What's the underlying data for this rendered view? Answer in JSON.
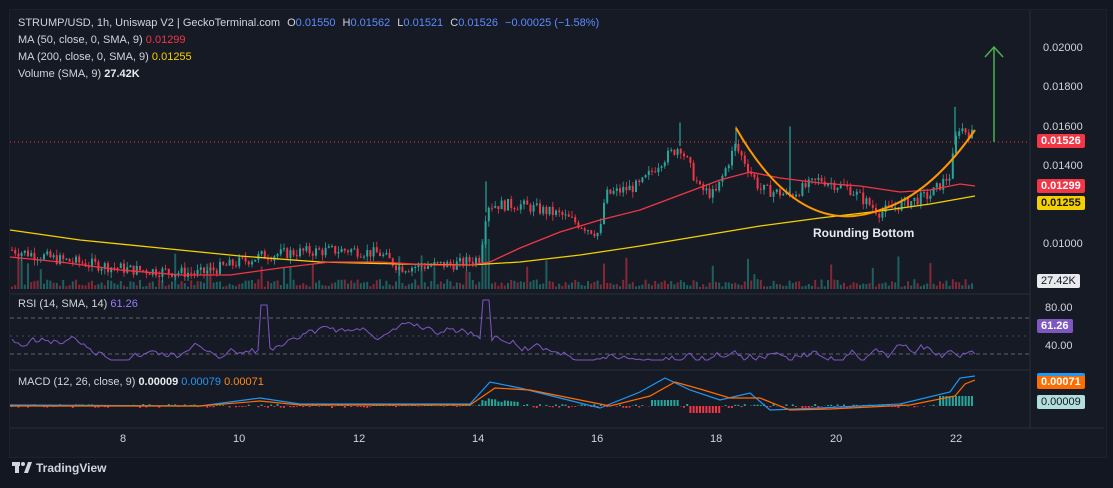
{
  "header": {
    "symbol": "STRUMP/USD, 1h, Uniswap V2 | GeckoTerminal.com",
    "o_label": "O",
    "o_value": "0.01550",
    "h_label": "H",
    "h_value": "0.01562",
    "l_label": "L",
    "l_value": "0.01521",
    "c_label": "C",
    "c_value": "0.01526",
    "change": "−0.00025 (−1.58%)"
  },
  "indicators": {
    "ma50_label": "MA (50, close, 0, SMA, 9)",
    "ma50_value": "0.01299",
    "ma200_label": "MA (200, close, 0, SMA, 9)",
    "ma200_value": "0.01255",
    "volume_label": "Volume (SMA, 9)",
    "volume_value": "27.42K",
    "rsi_label": "RSI (14, SMA, 14)",
    "rsi_value": "61.26",
    "macd_label": "MACD (12, 26, close, 9)",
    "macd_v1": "0.00009",
    "macd_v2": "0.00079",
    "macd_v3": "0.00071"
  },
  "price_axis": [
    "0.02000",
    "0.01800",
    "0.01600",
    "0.01400",
    "0.01000"
  ],
  "price_tags": {
    "last": "0.01526",
    "ma50": "0.01299",
    "ma200": "0.01255",
    "volume": "27.42K"
  },
  "rsi_axis": [
    "80.00",
    "40.00"
  ],
  "rsi_tag": "61.26",
  "macd_tags": {
    "signal": "0.00071",
    "hist": "0.00009"
  },
  "time_axis": [
    "8",
    "10",
    "12",
    "14",
    "16",
    "18",
    "20",
    "22"
  ],
  "annotation": "Rounding Bottom",
  "footer": {
    "brand": "TradingView"
  },
  "colors": {
    "bg": "#131722",
    "up": "#26a69a",
    "down": "#f23645",
    "ma50": "#f23645",
    "ma200": "#f5d000",
    "rsi": "#7e57c2",
    "macd": "#2196f3",
    "signal": "#ff6d00",
    "arrow": "#4caf50"
  }
}
